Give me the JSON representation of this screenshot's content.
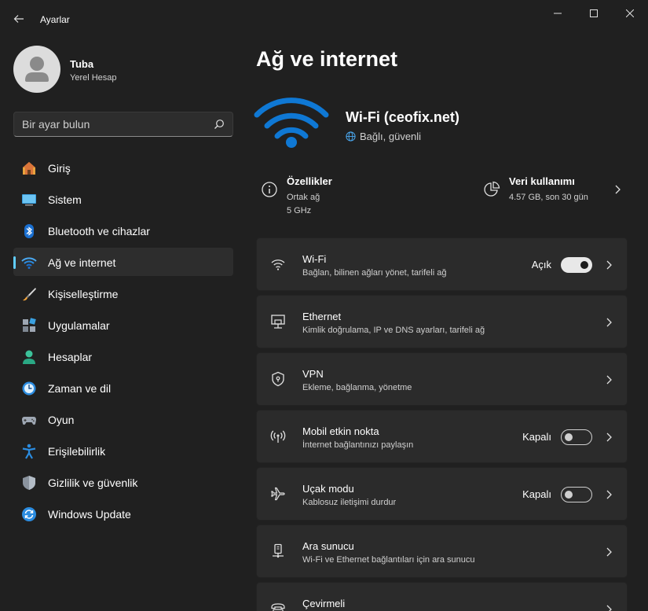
{
  "window": {
    "title": "Ayarlar"
  },
  "profile": {
    "name": "Tuba",
    "account_type": "Yerel Hesap"
  },
  "search": {
    "placeholder": "Bir ayar bulun"
  },
  "nav": {
    "items": [
      {
        "label": "Giriş",
        "icon": "home-icon"
      },
      {
        "label": "Sistem",
        "icon": "system-icon"
      },
      {
        "label": "Bluetooth ve cihazlar",
        "icon": "bluetooth-icon"
      },
      {
        "label": "Ağ ve internet",
        "icon": "network-icon",
        "active": true
      },
      {
        "label": "Kişiselleştirme",
        "icon": "brush-icon"
      },
      {
        "label": "Uygulamalar",
        "icon": "apps-icon"
      },
      {
        "label": "Hesaplar",
        "icon": "accounts-icon"
      },
      {
        "label": "Zaman ve dil",
        "icon": "time-language-icon"
      },
      {
        "label": "Oyun",
        "icon": "gamepad-icon"
      },
      {
        "label": "Erişilebilirlik",
        "icon": "accessibility-icon"
      },
      {
        "label": "Gizlilik ve güvenlik",
        "icon": "shield-icon"
      },
      {
        "label": "Windows Update",
        "icon": "update-icon"
      }
    ]
  },
  "main": {
    "title": "Ağ ve internet",
    "connection": {
      "name": "Wi-Fi (ceofix.net)",
      "status": "Bağlı, güvenli"
    },
    "properties": {
      "title": "Özellikler",
      "lines": [
        "Ortak ağ",
        "5 GHz"
      ]
    },
    "data_usage": {
      "title": "Veri kullanımı",
      "value": "4.57 GB, son 30 gün"
    },
    "cards": [
      {
        "title": "Wi-Fi",
        "subtitle": "Bağlan, bilinen ağları yönet, tarifeli ağ",
        "state": "Açık",
        "toggle": "on",
        "icon": "wifi-icon"
      },
      {
        "title": "Ethernet",
        "subtitle": "Kimlik doğrulama, IP ve DNS ayarları, tarifeli ağ",
        "icon": "ethernet-icon"
      },
      {
        "title": "VPN",
        "subtitle": "Ekleme, bağlanma, yönetme",
        "icon": "vpn-shield-icon"
      },
      {
        "title": "Mobil etkin nokta",
        "subtitle": "İnternet bağlantınızı paylaşın",
        "state": "Kapalı",
        "toggle": "off",
        "icon": "hotspot-icon"
      },
      {
        "title": "Uçak modu",
        "subtitle": "Kablosuz iletişimi durdur",
        "state": "Kapalı",
        "toggle": "off",
        "icon": "airplane-icon"
      },
      {
        "title": "Ara sunucu",
        "subtitle": "Wi-Fi ve Ethernet bağlantıları için ara sunucu",
        "icon": "proxy-icon"
      },
      {
        "title": "Çevirmeli",
        "subtitle": "",
        "icon": "dialup-icon"
      }
    ]
  },
  "colors": {
    "accent": "#60cdff",
    "wifi_blue": "#0f78d4",
    "background": "#202020",
    "card": "#2b2b2b"
  }
}
